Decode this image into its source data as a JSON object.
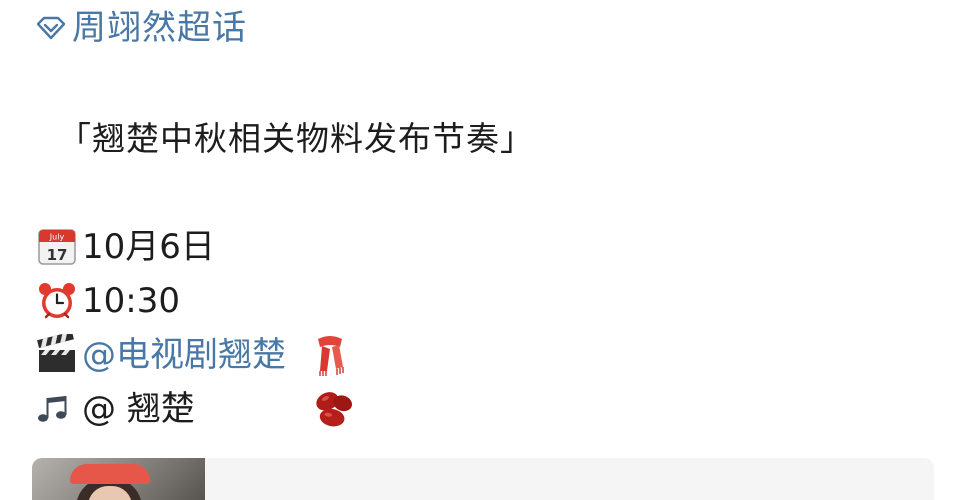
{
  "topic": {
    "label": "周翊然超话",
    "icon": "diamond-icon",
    "color": "#4a78a6"
  },
  "post": {
    "headline": "「翘楚中秋相关物料发布节奏」",
    "date": {
      "icon": "calendar-icon",
      "calendar_month": "July",
      "calendar_day": "17",
      "text": "10月6日"
    },
    "time": {
      "icon": "alarm-clock-icon",
      "text": "10:30"
    },
    "account_drama": {
      "icon": "clapper-board-icon",
      "mention": "@电视剧翘楚",
      "trail_icon": "scarf-icon"
    },
    "account_music": {
      "icon": "musical-notes-icon",
      "text": "@ 翘楚",
      "trail_icon": "beans-icon"
    }
  },
  "link_card": {
    "thumbnail": "video-thumbnail"
  }
}
